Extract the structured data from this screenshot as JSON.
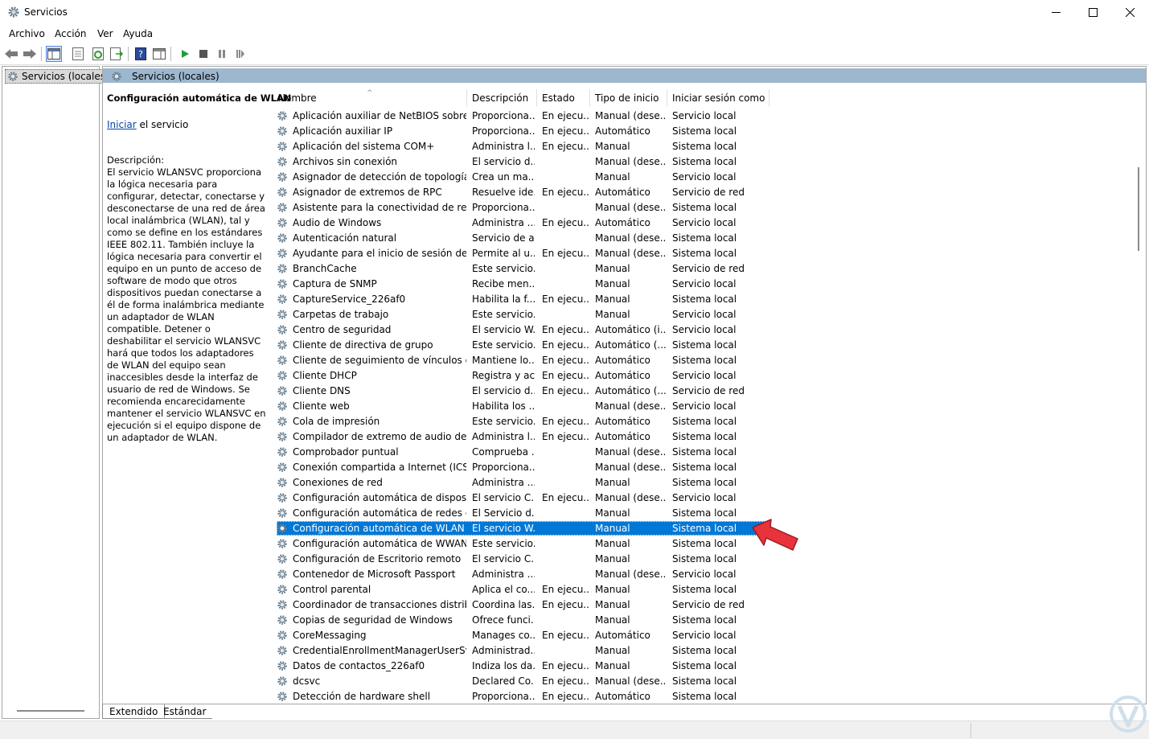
{
  "window": {
    "title": "Servicios"
  },
  "menu": [
    "Archivo",
    "Acción",
    "Ver",
    "Ayuda"
  ],
  "tree": {
    "root_label": "Servicios (locales)"
  },
  "pane": {
    "header": "Servicios (locales)"
  },
  "details": {
    "title": "Configuración automática de WLAN",
    "action_link": "Iniciar",
    "action_suffix": " el servicio",
    "desc_label": "Descripción:",
    "desc_text": "El servicio WLANSVC proporciona la lógica necesaria para configurar, detectar, conectarse y desconectarse de una red de área local inalámbrica (WLAN), tal y como se define en los estándares IEEE 802.11. También incluye la lógica necesaria para convertir el equipo en un punto de acceso de software de modo que otros dispositivos puedan conectarse a él de forma inalámbrica mediante un adaptador de WLAN compatible. Detener o deshabilitar el servicio WLANSVC hará que todos los adaptadores de WLAN del equipo sean inaccesibles desde la interfaz de usuario de red de Windows. Se recomienda encarecidamente mantener el servicio WLANSVC en ejecución si el equipo dispone de un adaptador de WLAN."
  },
  "columns": [
    "Nombre",
    "Descripción",
    "Estado",
    "Tipo de inicio",
    "Iniciar sesión como"
  ],
  "services": [
    [
      "Aplicación auxiliar de NetBIOS sobre TC...",
      "Proporciona...",
      "En ejecu...",
      "Manual (dese...",
      "Servicio local"
    ],
    [
      "Aplicación auxiliar IP",
      "Proporciona...",
      "En ejecu...",
      "Automático",
      "Sistema local"
    ],
    [
      "Aplicación del sistema COM+",
      "Administra l...",
      "En ejecu...",
      "Manual",
      "Sistema local"
    ],
    [
      "Archivos sin conexión",
      "El servicio d...",
      "",
      "Manual (dese...",
      "Sistema local"
    ],
    [
      "Asignador de detección de topologías ...",
      "Crea un ma...",
      "",
      "Manual",
      "Servicio local"
    ],
    [
      "Asignador de extremos de RPC",
      "Resuelve ide...",
      "En ejecu...",
      "Automático",
      "Servicio de red"
    ],
    [
      "Asistente para la conectividad de red",
      "Proporciona...",
      "",
      "Manual (dese...",
      "Sistema local"
    ],
    [
      "Audio de Windows",
      "Administra ...",
      "En ejecu...",
      "Automático",
      "Servicio local"
    ],
    [
      "Autenticación natural",
      "Servicio de a...",
      "",
      "Manual (dese...",
      "Sistema local"
    ],
    [
      "Ayudante para el inicio de sesión de cu...",
      "Permite al u...",
      "En ejecu...",
      "Manual (dese...",
      "Sistema local"
    ],
    [
      "BranchCache",
      "Este servicio...",
      "",
      "Manual",
      "Servicio de red"
    ],
    [
      "Captura de SNMP",
      "Recibe men...",
      "",
      "Manual",
      "Servicio local"
    ],
    [
      "CaptureService_226af0",
      "Habilita la f...",
      "En ejecu...",
      "Manual",
      "Sistema local"
    ],
    [
      "Carpetas de trabajo",
      "Este servicio...",
      "",
      "Manual",
      "Servicio local"
    ],
    [
      "Centro de seguridad",
      "El servicio W...",
      "En ejecu...",
      "Automático (i...",
      "Servicio local"
    ],
    [
      "Cliente de directiva de grupo",
      "Este servicio...",
      "En ejecu...",
      "Automático (...",
      "Sistema local"
    ],
    [
      "Cliente de seguimiento de vínculos dist...",
      "Mantiene lo...",
      "En ejecu...",
      "Automático",
      "Sistema local"
    ],
    [
      "Cliente DHCP",
      "Registra y ac...",
      "En ejecu...",
      "Automático",
      "Servicio local"
    ],
    [
      "Cliente DNS",
      "El servicio d...",
      "En ejecu...",
      "Automático (...",
      "Servicio de red"
    ],
    [
      "Cliente web",
      "Habilita los ...",
      "",
      "Manual (dese...",
      "Servicio local"
    ],
    [
      "Cola de impresión",
      "Este servicio...",
      "En ejecu...",
      "Automático",
      "Sistema local"
    ],
    [
      "Compilador de extremo de audio de Wi...",
      "Administra l...",
      "En ejecu...",
      "Automático",
      "Sistema local"
    ],
    [
      "Comprobador puntual",
      "Comprueba ...",
      "",
      "Manual (dese...",
      "Sistema local"
    ],
    [
      "Conexión compartida a Internet (ICS)",
      "Proporciona...",
      "",
      "Manual (dese...",
      "Sistema local"
    ],
    [
      "Conexiones de red",
      "Administra ...",
      "",
      "Manual",
      "Sistema local"
    ],
    [
      "Configuración automática de dispositiv...",
      "El servicio C...",
      "En ejecu...",
      "Manual (dese...",
      "Servicio local"
    ],
    [
      "Configuración automática de redes cab...",
      "El Servicio d...",
      "",
      "Manual",
      "Sistema local"
    ],
    [
      "Configuración automática de WLAN",
      "El servicio W...",
      "",
      "Manual",
      "Sistema local"
    ],
    [
      "Configuración automática de WWAN",
      "Este servicio...",
      "",
      "Manual",
      "Sistema local"
    ],
    [
      "Configuración de Escritorio remoto",
      "El servicio C...",
      "",
      "Manual",
      "Sistema local"
    ],
    [
      "Contenedor de Microsoft Passport",
      "Administra ...",
      "",
      "Manual (dese...",
      "Servicio local"
    ],
    [
      "Control parental",
      "Aplica el co...",
      "En ejecu...",
      "Manual",
      "Sistema local"
    ],
    [
      "Coordinador de transacciones distribui...",
      "Coordina las...",
      "En ejecu...",
      "Manual",
      "Servicio de red"
    ],
    [
      "Copias de seguridad de Windows",
      "Ofrece funci...",
      "",
      "Manual",
      "Sistema local"
    ],
    [
      "CoreMessaging",
      "Manages co...",
      "En ejecu...",
      "Automático",
      "Servicio local"
    ],
    [
      "CredentialEnrollmentManagerUserSvc_...",
      "Administrad...",
      "",
      "Manual",
      "Sistema local"
    ],
    [
      "Datos de contactos_226af0",
      "Indiza los da...",
      "En ejecu...",
      "Manual",
      "Sistema local"
    ],
    [
      "dcsvc",
      "Declared Co...",
      "En ejecu...",
      "Manual (dese...",
      "Sistema local"
    ],
    [
      "Detección de hardware shell",
      "Proporciona...",
      "En ejecu...",
      "Automático",
      "Sistema local"
    ]
  ],
  "selected_index": 27,
  "tabs": [
    "Extendido",
    "Estándar"
  ],
  "colors": {
    "selection": "#0078d7",
    "pane_header": "#9db7cf",
    "arrow": "#e8323c"
  }
}
